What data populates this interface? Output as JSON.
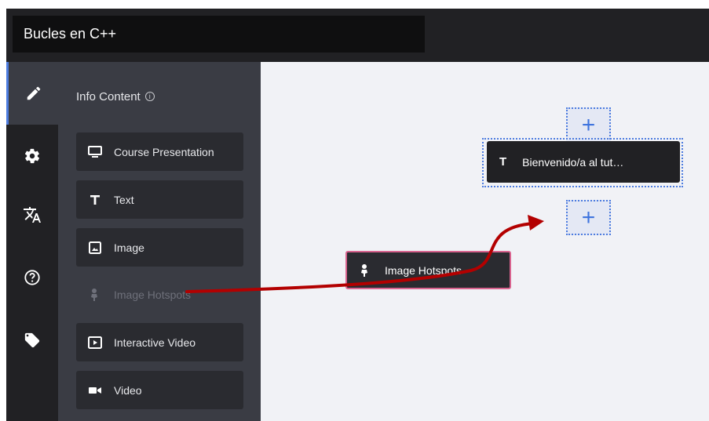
{
  "header": {
    "title": "Bucles en C++"
  },
  "iconbar": {
    "items": [
      {
        "icon": "pencil-icon",
        "active": true
      },
      {
        "icon": "gear-icon",
        "active": false
      },
      {
        "icon": "translate-icon",
        "active": false
      },
      {
        "icon": "help-icon",
        "active": false
      },
      {
        "icon": "tag-icon",
        "active": false
      }
    ]
  },
  "panel": {
    "title": "Info Content",
    "info_glyph": "i",
    "content_types": [
      {
        "label": "Course Presentation",
        "icon": "monitor-icon"
      },
      {
        "label": "Text",
        "icon": "text-t-icon"
      },
      {
        "label": "Image",
        "icon": "image-icon"
      },
      {
        "label": "Image Hotspots",
        "icon": "hotspot-pin-icon",
        "state": "dragging-source"
      },
      {
        "label": "Interactive Video",
        "icon": "play-box-icon"
      },
      {
        "label": "Video",
        "icon": "video-camera-icon"
      }
    ]
  },
  "canvas": {
    "add_glyph": "+",
    "blocks": [
      {
        "type_glyph": "T",
        "label": "Bienvenido/a al tut…",
        "selected": true
      }
    ],
    "dragging": {
      "label": "Image Hotspots",
      "icon": "hotspot-pin-icon"
    }
  },
  "colors": {
    "accent": "#4d7cdf",
    "drag_outline": "#d9648f",
    "arrow": "#b30000",
    "dark": "#212124",
    "panel": "#3a3c44"
  }
}
